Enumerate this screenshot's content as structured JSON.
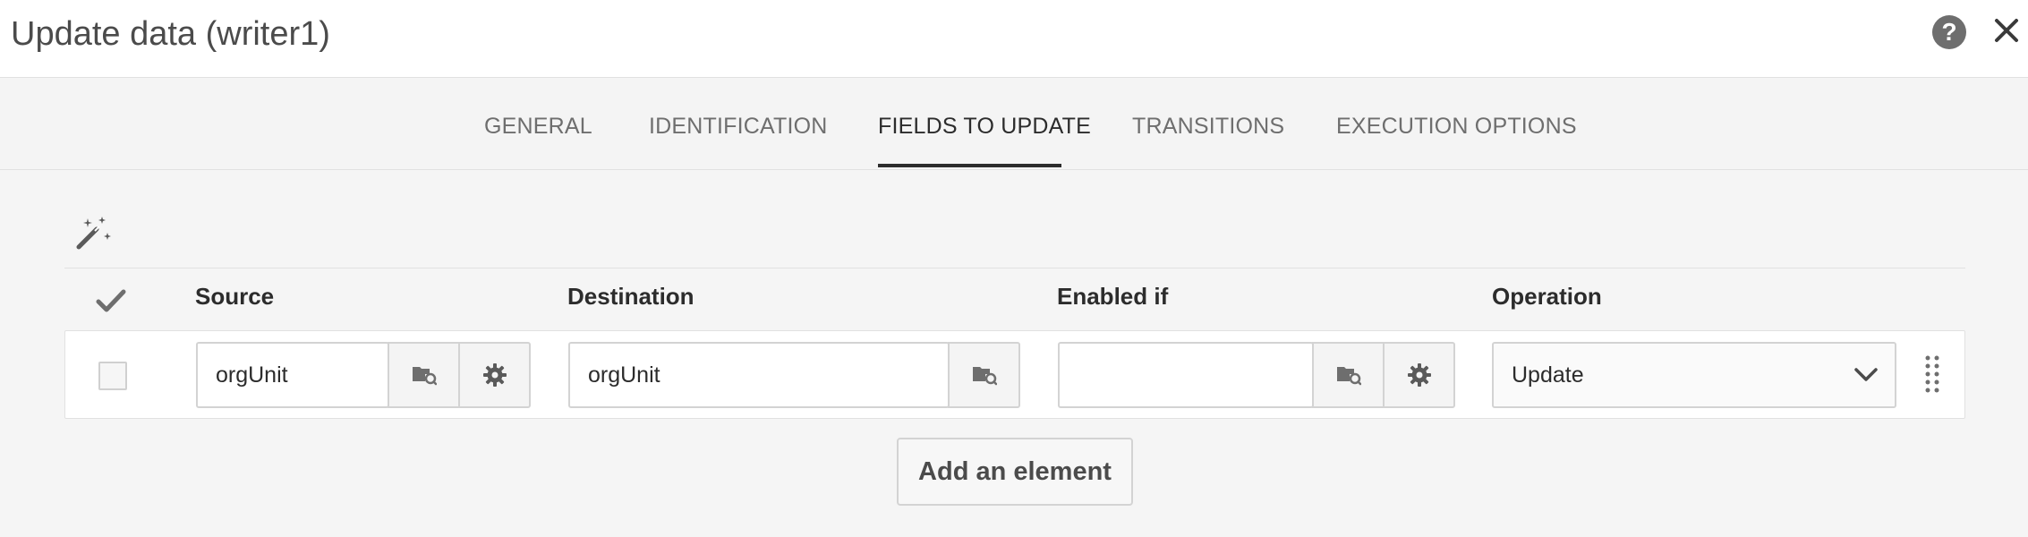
{
  "window": {
    "title": "Update data (writer1)",
    "help_icon": "help-icon",
    "help_glyph": "?",
    "close_icon": "close-icon"
  },
  "tabs": [
    {
      "label": "GENERAL",
      "active": false
    },
    {
      "label": "IDENTIFICATION",
      "active": false
    },
    {
      "label": "FIELDS TO UPDATE",
      "active": true
    },
    {
      "label": "TRANSITIONS",
      "active": false
    },
    {
      "label": "EXECUTION OPTIONS",
      "active": false
    }
  ],
  "toolbar": {
    "wand_icon": "magic-wand-icon"
  },
  "table": {
    "columns": {
      "check_icon": "checkmark-icon",
      "source": "Source",
      "destination": "Destination",
      "enabled_if": "Enabled if",
      "operation": "Operation"
    },
    "rows": [
      {
        "checked": false,
        "source": "orgUnit",
        "destination": "orgUnit",
        "enabled_if": "",
        "operation": "Update"
      }
    ]
  },
  "actions": {
    "add_element_label": "Add an element"
  },
  "colors": {
    "accent": "#2c2c2c",
    "header_bg": "#ffffff",
    "page_bg": "#f5f5f5",
    "icon_gray": "#6e6e6e"
  }
}
